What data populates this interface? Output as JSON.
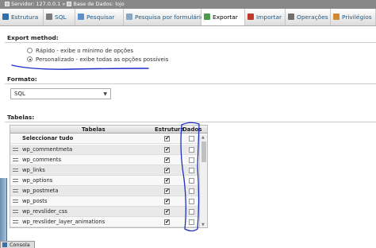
{
  "breadcrumb": {
    "server": "Servidor: 127.0.0.1",
    "separator": "»",
    "database": "Base de Dados: lojo"
  },
  "tabs": [
    {
      "label": "Estrutura",
      "icon": "structure-icon",
      "color": "#2f6fa8"
    },
    {
      "label": "SQL",
      "icon": "sql-icon",
      "color": "#7a7a7a"
    },
    {
      "label": "Pesquisar",
      "icon": "search-icon",
      "color": "#5b8fc7"
    },
    {
      "label": "Pesquisa por formulário",
      "icon": "query-icon",
      "color": "#8aa7c4"
    },
    {
      "label": "Exportar",
      "icon": "export-icon",
      "color": "#4b9b4b",
      "active": true
    },
    {
      "label": "Importar",
      "icon": "import-icon",
      "color": "#c0392b"
    },
    {
      "label": "Operações",
      "icon": "wrench-icon",
      "color": "#6f6f6f"
    },
    {
      "label": "Privilégios",
      "icon": "users-icon",
      "color": "#d28a2e"
    }
  ],
  "export_method": {
    "label": "Export method:",
    "options": [
      {
        "label": "Rápido - exibe o mínimo de opções",
        "selected": false
      },
      {
        "label": "Personalizado - exibe todas as opções possíveis",
        "selected": true
      }
    ]
  },
  "format": {
    "label": "Formato:",
    "value": "SQL"
  },
  "tables": {
    "label": "Tabelas:",
    "headers": {
      "tables": "Tabelas",
      "structure": "Estrutura",
      "data": "Dados"
    },
    "select_all": "Seleccionar tudo",
    "rows": [
      {
        "name": "wp_commentmeta",
        "structure": true,
        "data": false
      },
      {
        "name": "wp_comments",
        "structure": true,
        "data": false
      },
      {
        "name": "wp_links",
        "structure": true,
        "data": false
      },
      {
        "name": "wp_options",
        "structure": true,
        "data": false
      },
      {
        "name": "wp_postmeta",
        "structure": true,
        "data": false
      },
      {
        "name": "wp_posts",
        "structure": true,
        "data": false
      },
      {
        "name": "wp_revslider_css",
        "structure": true,
        "data": false
      },
      {
        "name": "wp_revslider_layer_animations",
        "structure": true,
        "data": false
      }
    ]
  },
  "console": {
    "label": "Consola"
  },
  "annotation_color": "#1f2fc7"
}
